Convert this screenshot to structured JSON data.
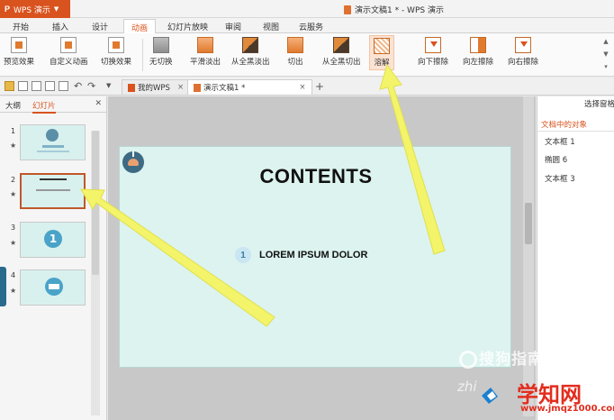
{
  "app": {
    "name": "WPS 演示",
    "window_title": "演示文稿1 * - WPS 演示"
  },
  "ribbon_tabs": [
    "开始",
    "插入",
    "设计",
    "动画",
    "幻灯片放映",
    "审阅",
    "视图",
    "云服务"
  ],
  "ribbon_buttons": {
    "preview": "预览效果",
    "custom_anim": "自定义动画",
    "switch_effect": "切换效果",
    "none": "无切换",
    "smooth_fade": "平滑淡出",
    "fade_black": "从全黑淡出",
    "cut": "切出",
    "cut_black": "从全黑切出",
    "dissolve": "溶解",
    "wipe_down": "向下擦除",
    "wipe_left": "向左擦除",
    "wipe_right": "向右擦除"
  },
  "doc_tabs": {
    "my_wps": "我的WPS",
    "doc1": "演示文稿1 *"
  },
  "left_panel": {
    "tab_outline": "大纲",
    "tab_slides": "幻灯片",
    "thumbs": [
      {
        "n": "1"
      },
      {
        "n": "2"
      },
      {
        "n": "3"
      },
      {
        "n": "4"
      }
    ]
  },
  "slide": {
    "title": "CONTENTS",
    "item_num": "1",
    "item_text": "LOREM IPSUM DOLOR"
  },
  "right_panel": {
    "header": "选择窗格",
    "section": "文档中的对象",
    "objects": [
      "文本框 1",
      "椭圆 6",
      "文本框 3"
    ]
  },
  "watermarks": {
    "sogou": "搜狗指南",
    "zhi": "zhi",
    "xuezhiwang": "学知网",
    "site": "www.jmqz1000.com"
  },
  "colors": {
    "accent": "#d9531e",
    "slide_bg": "#dcf3ef",
    "arrow": "#f4f46a"
  }
}
